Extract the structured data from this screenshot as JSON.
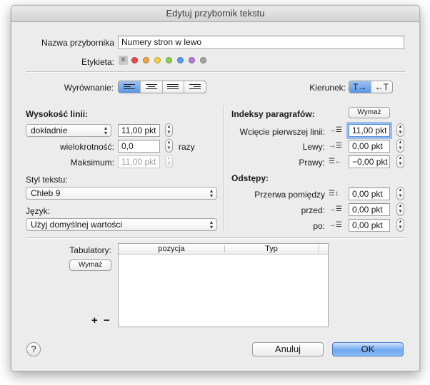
{
  "window": {
    "title": "Edytuj przybornik tekstu"
  },
  "toolbox_name": {
    "label": "Nazwa przybornika",
    "value": "Numery stron w lewo"
  },
  "tags": {
    "label": "Etykieta:",
    "none_symbol": "✕",
    "colors": [
      "#e84d4d",
      "#f2a33a",
      "#f0d23c",
      "#8cd04a",
      "#5a9cf0",
      "#b778d8",
      "#a5a5a5"
    ]
  },
  "alignment": {
    "label": "Wyrównanie:",
    "options": [
      "left",
      "center",
      "justify",
      "right"
    ],
    "selected": "left"
  },
  "direction": {
    "label": "Kierunek:",
    "options": [
      "T→",
      "←T"
    ],
    "selected": "T→"
  },
  "line_height": {
    "heading": "Wysokość linii:",
    "mode": "dokładnie",
    "value": "11,00 pkt",
    "multiple_label": "wielokrotność:",
    "multiple_value": "0,0",
    "multiple_unit": "razy",
    "max_label": "Maksimum:",
    "max_value": "11,00 pkt"
  },
  "text_style": {
    "label": "Styl tekstu:",
    "value": "Chleb 9"
  },
  "language": {
    "label": "Język:",
    "value": "Użyj domyślnej wartości"
  },
  "indents": {
    "heading": "Indeksy paragrafów:",
    "clear_label": "Wymaż",
    "first_line_label": "Wcięcie pierwszej linii:",
    "first_line_value": "11,00 pkt",
    "left_label": "Lewy:",
    "left_value": "0,00 pkt",
    "right_label": "Prawy:",
    "right_value": "−0,00 pkt"
  },
  "spacing": {
    "heading": "Odstępy:",
    "between_label": "Przerwa pomiędzy",
    "between_value": "0,00 pkt",
    "before_label": "przed:",
    "before_value": "0,00 pkt",
    "after_label": "po:",
    "after_value": "0,00 pkt"
  },
  "tabs": {
    "label": "Tabulatory:",
    "clear_label": "Wymaż",
    "columns": [
      "pozycja",
      "Typ"
    ],
    "add_symbol": "+",
    "remove_symbol": "−"
  },
  "footer": {
    "help_symbol": "?",
    "cancel_label": "Anuluj",
    "ok_label": "OK"
  }
}
